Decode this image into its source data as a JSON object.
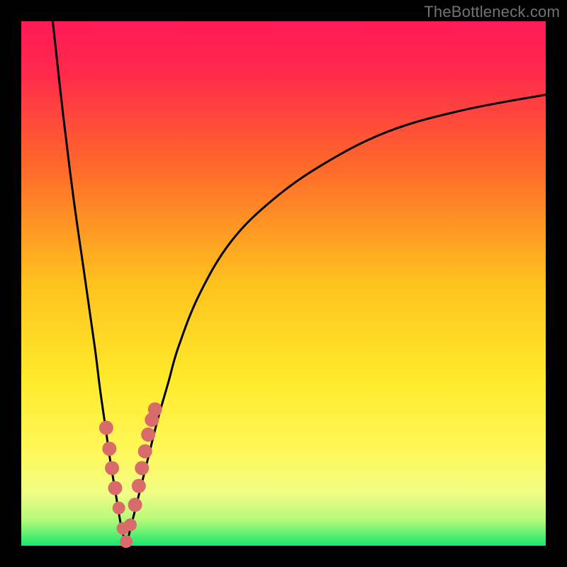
{
  "watermark": "TheBottleneck.com",
  "colors": {
    "frame": "#000000",
    "gradient_stops": [
      {
        "pos": 0.0,
        "color": "#ff1a57"
      },
      {
        "pos": 0.1,
        "color": "#ff2a4a"
      },
      {
        "pos": 0.28,
        "color": "#ff6a2a"
      },
      {
        "pos": 0.5,
        "color": "#ffc21e"
      },
      {
        "pos": 0.68,
        "color": "#ffe92a"
      },
      {
        "pos": 0.82,
        "color": "#fff85a"
      },
      {
        "pos": 0.9,
        "color": "#f1fd86"
      },
      {
        "pos": 0.95,
        "color": "#b6fa7a"
      },
      {
        "pos": 1.0,
        "color": "#19e86b"
      }
    ],
    "curve": "#000000",
    "marker_fill": "#d96b6b",
    "marker_stroke": "#c54f4f"
  },
  "chart_data": {
    "type": "line",
    "title": "",
    "xlabel": "",
    "ylabel": "",
    "xlim": [
      0,
      100
    ],
    "ylim": [
      0,
      100
    ],
    "x_optimum": 20,
    "series": [
      {
        "name": "left-branch",
        "x": [
          6,
          8,
          10,
          12,
          14,
          15,
          16,
          17,
          18,
          19,
          20
        ],
        "y": [
          100,
          82,
          66,
          52,
          38,
          30,
          23,
          16,
          10,
          4,
          0
        ]
      },
      {
        "name": "right-branch",
        "x": [
          20,
          22,
          24,
          26,
          28,
          30,
          34,
          40,
          48,
          58,
          70,
          84,
          100
        ],
        "y": [
          0,
          8,
          16,
          24,
          31,
          38,
          48,
          58,
          66,
          73,
          79,
          83,
          86
        ]
      }
    ],
    "markers": {
      "name": "highlighted-points",
      "x": [
        16.2,
        16.8,
        17.3,
        17.9,
        18.6,
        19.4,
        20.0,
        20.8,
        21.7,
        22.4,
        23.0,
        23.6,
        24.2,
        24.9,
        25.5
      ],
      "y": [
        22.5,
        18.5,
        14.8,
        11.0,
        7.2,
        3.3,
        0.8,
        4.0,
        7.8,
        11.4,
        14.8,
        18.0,
        21.2,
        24.0,
        26.0
      ],
      "r": [
        10,
        10,
        10,
        10,
        9,
        9,
        9,
        9,
        10,
        10,
        10,
        10,
        10,
        10,
        10
      ]
    }
  }
}
